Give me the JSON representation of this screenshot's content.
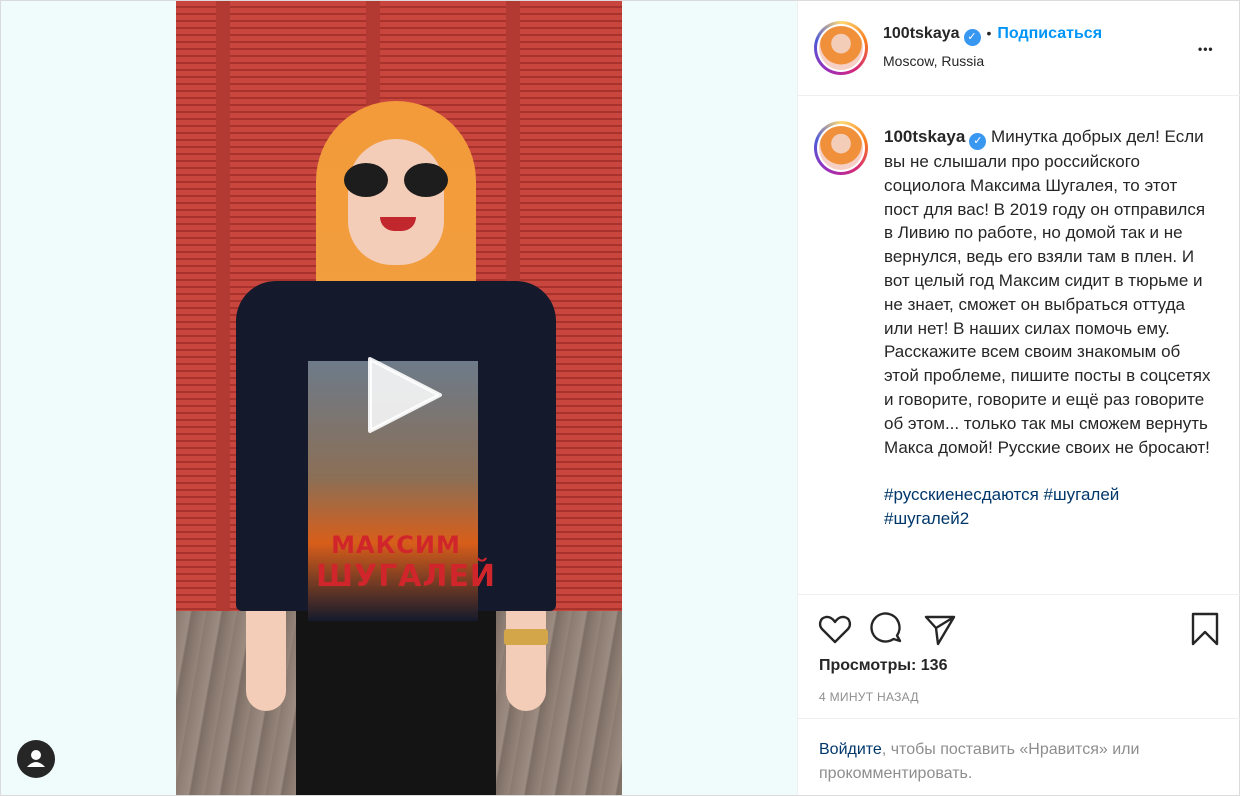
{
  "header": {
    "username": "100tskaya",
    "separator": "•",
    "follow_label": "Подписаться",
    "location": "Moscow, Russia",
    "more_label": "•••"
  },
  "post": {
    "shirt_line1": "МАКСИМ",
    "shirt_line2": "ШУГАЛЕЙ",
    "caption_username": "100tskaya",
    "caption_text": "Минутка добрых дел! Если вы не слышали про российского социолога Максима Шугалея, то этот пост для вас! В 2019 году он отправился в Ливию по работе, но домой так и не вернулся, ведь его взяли там в плен. И вот целый год Максим сидит в тюрьме и не знает, сможет он выбраться оттуда или нет! В наших силах помочь ему. Расскажите всем своим знакомым об этой проблеме, пишите посты в соцсетях и говорите, говорите и ещё раз говорите об этом... только так мы сможем вернуть Макса домой! Русские своих не бросают!",
    "hashtags": "#русскиенесдаются #шугалей",
    "hashtags_cut": "#шугалей2"
  },
  "actions": {
    "views": "Просмотры: 136",
    "time_ago": "4 МИНУТ НАЗАД"
  },
  "login_prompt": {
    "link": "Войдите",
    "rest": ", чтобы поставить «Нравится» или прокомментировать."
  },
  "colors": {
    "link_blue": "#0095f6",
    "hashtag_blue": "#00376b",
    "verified_blue": "#3897f0"
  },
  "icons": [
    "play-icon",
    "user-tag-icon",
    "verified-icon",
    "heart-icon",
    "comment-icon",
    "share-icon",
    "bookmark-icon",
    "more-icon"
  ]
}
